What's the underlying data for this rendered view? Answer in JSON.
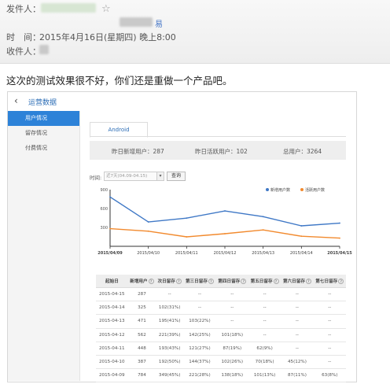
{
  "email": {
    "sender_label": "发件人：",
    "time_label": "时　间：",
    "time_value": "2015年4月16日(星期四) 晚上8:00",
    "recipient_label": "收件人：",
    "bracket_text": "易",
    "message": "这次的测试效果很不好，你们还是重做一个产品吧。"
  },
  "app": {
    "back_glyph": "‹",
    "title": "运营数据",
    "sidebar": [
      {
        "label": "用户情况",
        "active": true
      },
      {
        "label": "留存情况",
        "active": false
      },
      {
        "label": "付费情况",
        "active": false
      }
    ],
    "tab": "Android",
    "summary": {
      "new_users": "昨日新增用户：287",
      "active_users": "昨日活跃用户：102",
      "total_users": "总用户：3264"
    },
    "filter": {
      "time_label": "时间:",
      "date_range": "近7天(04.09-04.15)",
      "query_button": "查询"
    }
  },
  "chart_data": {
    "type": "line",
    "x": [
      "2015/04/09",
      "2015/04/10",
      "2015/04/11",
      "2015/04/12",
      "2015/04/13",
      "2015/04/14",
      "2015/04/15"
    ],
    "series": [
      {
        "name": "新增用户数",
        "color": "#3f78c6",
        "values": [
          784,
          387,
          448,
          562,
          471,
          325,
          368
        ]
      },
      {
        "name": "活跃用户数",
        "color": "#f28a2e",
        "values": [
          280,
          240,
          150,
          200,
          260,
          160,
          130
        ]
      }
    ],
    "y_ticks": [
      "900",
      "600",
      "300"
    ],
    "ylim": [
      0,
      900
    ],
    "legend": "top-right"
  },
  "retention_table": {
    "headers": [
      "起始日",
      "新增用户",
      "次日留存",
      "第三日留存",
      "第四日留存",
      "第五日留存",
      "第六日留存",
      "第七日留存"
    ],
    "rows": [
      [
        "2015-04-15",
        "287",
        "--",
        "--",
        "--",
        "--",
        "--",
        "--"
      ],
      [
        "2015-04-14",
        "325",
        "102(31%)",
        "--",
        "--",
        "--",
        "--",
        "--"
      ],
      [
        "2015-04-13",
        "471",
        "195(41%)",
        "103(22%)",
        "--",
        "--",
        "--",
        "--"
      ],
      [
        "2015-04-12",
        "562",
        "221(39%)",
        "142(25%)",
        "101(18%)",
        "--",
        "--",
        "--"
      ],
      [
        "2015-04-11",
        "448",
        "193(43%)",
        "121(27%)",
        "87(19%)",
        "62(9%)",
        "--",
        "--"
      ],
      [
        "2015-04-10",
        "387",
        "192(50%)",
        "144(37%)",
        "102(26%)",
        "70(18%)",
        "45(12%)",
        "--"
      ],
      [
        "2015-04-09",
        "784",
        "349(45%)",
        "221(28%)",
        "138(18%)",
        "101(13%)",
        "87(11%)",
        "63(8%)"
      ]
    ]
  }
}
